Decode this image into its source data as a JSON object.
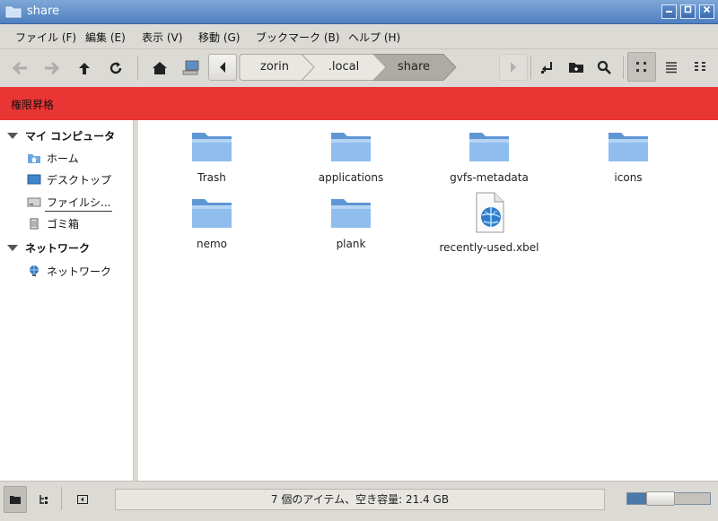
{
  "window": {
    "title": "share"
  },
  "menu": [
    "ファイル (F)",
    "編集 (E)",
    "表示 (V)",
    "移動 (G)",
    "ブックマーク (B)",
    "ヘルプ (H)"
  ],
  "breadcrumbs": [
    "zorin",
    ".local",
    "share"
  ],
  "banner": {
    "text": "権限昇格",
    "color": "#ea3535"
  },
  "sidebar": {
    "sections": [
      {
        "label": "マイ コンピュータ",
        "items": [
          {
            "label": "ホーム",
            "icon": "home-folder-icon"
          },
          {
            "label": "デスクトップ",
            "icon": "desktop-icon"
          },
          {
            "label": "ファイルシ...",
            "icon": "drive-icon"
          },
          {
            "label": "ゴミ箱",
            "icon": "trash-icon"
          }
        ]
      },
      {
        "label": "ネットワーク",
        "items": [
          {
            "label": "ネットワーク",
            "icon": "network-icon"
          }
        ]
      }
    ]
  },
  "files": [
    {
      "name": "Trash",
      "type": "folder"
    },
    {
      "name": "applications",
      "type": "folder"
    },
    {
      "name": "gvfs-metadata",
      "type": "folder"
    },
    {
      "name": "icons",
      "type": "folder"
    },
    {
      "name": "nemo",
      "type": "folder"
    },
    {
      "name": "plank",
      "type": "folder"
    },
    {
      "name": "recently-used.xbel",
      "type": "xml-document"
    }
  ],
  "status": {
    "text": "7 個のアイテム、空き容量: 21.4 GB"
  },
  "zoom": {
    "level": 0.35
  },
  "colors": {
    "accent": "#4f7fbf",
    "folder": "#7fb0e8"
  }
}
